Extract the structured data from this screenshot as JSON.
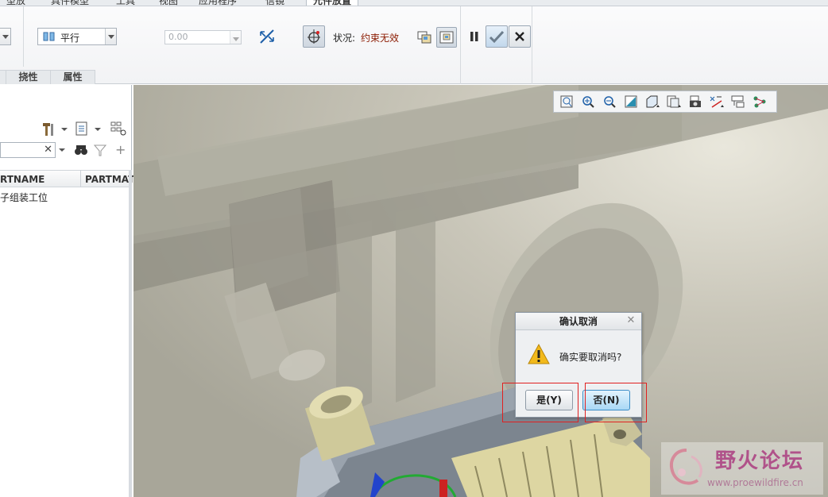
{
  "tabs": [
    {
      "label": "型放"
    },
    {
      "label": "具件模型"
    },
    {
      "label": "工具"
    },
    {
      "label": "视图"
    },
    {
      "label": "应用程序"
    },
    {
      "label": "信镜"
    },
    {
      "label": "元件放置"
    }
  ],
  "ribbon": {
    "constraint_type": "平行",
    "offset_value": "0.00",
    "status_label": "状况:",
    "status_value": "约束无效",
    "groups": [
      "挠性",
      "属性"
    ]
  },
  "tree": {
    "filter_value": "",
    "columns": [
      "RTNAME",
      "PARTMAT"
    ],
    "rows": [
      {
        "name": "子组装工位"
      }
    ]
  },
  "view_toolbar": {
    "icons": [
      "refit-icon",
      "zoom-in-icon",
      "zoom-out-icon",
      "repaint-icon",
      "display-style-icon",
      "saved-views-icon",
      "view-manager-icon",
      "datum-display-icon",
      "annotation-display-icon",
      "spin-center-icon"
    ]
  },
  "dialog": {
    "title": "确认取消",
    "message": "确实要取消吗?",
    "yes_label": "是(Y)",
    "no_label": "否(N)"
  },
  "watermark": {
    "title": "野火论坛",
    "url": "www.proewildfire.cn"
  },
  "colors": {
    "accent": "#3d8ec7",
    "status_text": "#8b1a00",
    "highlight_box": "#e02020",
    "watermark": "#b0528a"
  }
}
